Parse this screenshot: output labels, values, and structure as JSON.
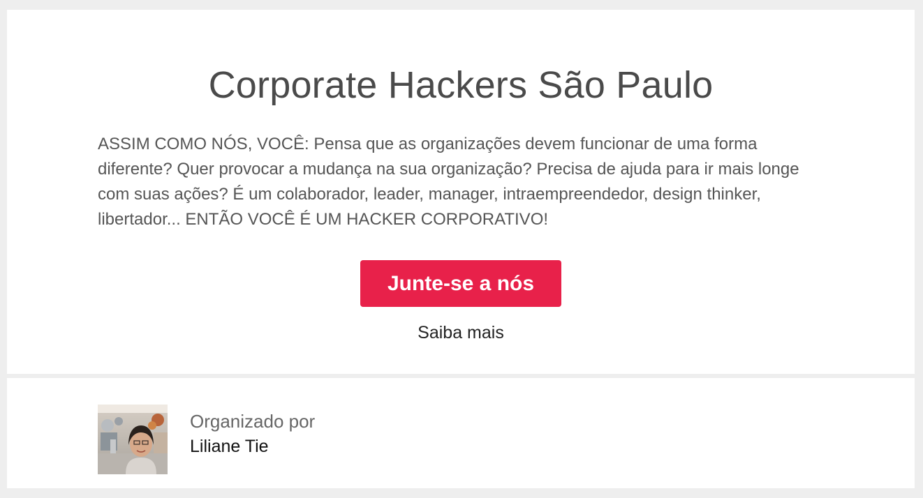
{
  "group": {
    "title": "Corporate Hackers São Paulo",
    "description": "ASSIM COMO NÓS, VOCÊ: Pensa que as organizações devem funcionar de uma forma diferente? Quer provocar a mudança na sua organização? Precisa de ajuda para ir mais longe com suas ações? É um colaborador, leader, manager, intraempreendedor, design thinker, libertador... ENTÃO VOCÊ É UM HACKER CORPORATIVO!"
  },
  "actions": {
    "join_label": "Junte-se a nós",
    "learn_more_label": "Saiba mais"
  },
  "organizer": {
    "label": "Organizado por",
    "name": "Liliane Tie"
  },
  "colors": {
    "accent": "#e8214a",
    "background": "#eeeeee"
  }
}
